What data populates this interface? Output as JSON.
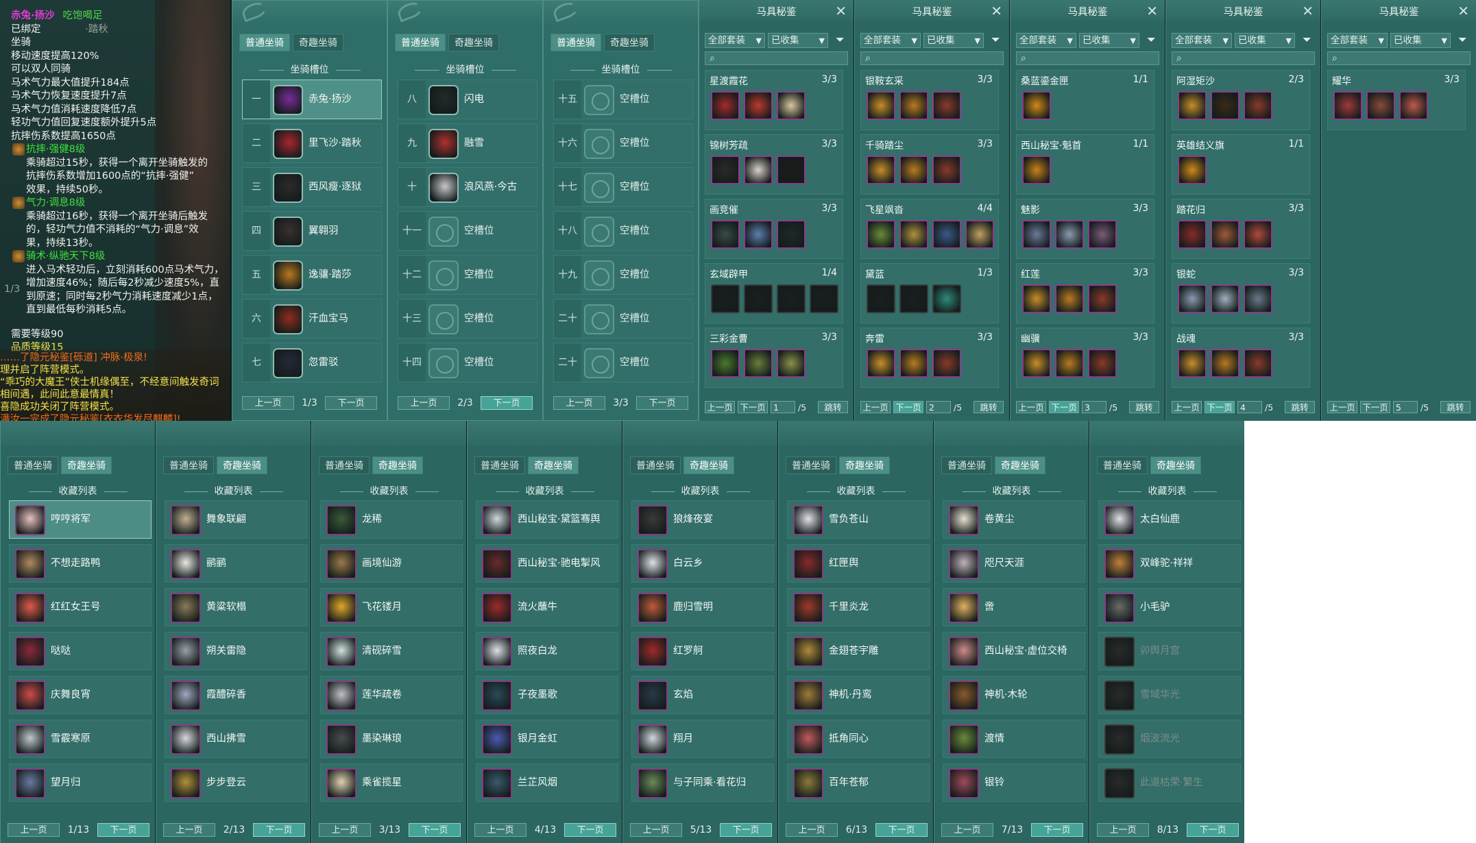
{
  "tooltip": {
    "title": "赤兔·扬沙",
    "title_sub": "吃饱喝足",
    "lines": [
      {
        "text": "已绑定",
        "color": "white",
        "extra": "·踏秋",
        "extra_color": "gray"
      },
      {
        "text": "坐骑",
        "color": "white"
      },
      {
        "text": "移动速度提高120%",
        "color": "white"
      },
      {
        "text": "可以双人同骑",
        "color": "white"
      },
      {
        "text": "马术气力最大值提升184点",
        "color": "white"
      },
      {
        "text": "马术气力恢复速度提升7点",
        "color": "white"
      },
      {
        "text": "马术气力值消耗速度降低7点",
        "color": "white"
      },
      {
        "text": "轻功气力值回复速度额外提升5点",
        "color": "white"
      },
      {
        "text": "抗摔伤系数提高1650点",
        "color": "white"
      },
      {
        "text": "抗摔·强健8级",
        "color": "green",
        "icon": true
      },
      {
        "text": "乘骑超过15秒，获得一个离开坐骑触发的",
        "color": "white",
        "ind": true
      },
      {
        "text": "抗摔伤系数增加1600点的“抗摔·强健”",
        "color": "white",
        "ind": true
      },
      {
        "text": "效果，持续50秒。",
        "color": "white",
        "ind": true
      },
      {
        "text": "气力·调息8级",
        "color": "green",
        "icon": true
      },
      {
        "text": "乘骑超过16秒，获得一个离开坐骑后触发",
        "color": "white",
        "ind": true
      },
      {
        "text": "的，轻功气力值不消耗的“气力·调息”效",
        "color": "white",
        "ind": true
      },
      {
        "text": "果，持续13秒。",
        "color": "white",
        "ind": true
      },
      {
        "text": "骑术·纵驰天下8级",
        "color": "green",
        "icon": true
      },
      {
        "text": "进入马术轻功后，立刻消耗600点马术气力，",
        "color": "white",
        "ind": true
      },
      {
        "text": "增加速度46%；随后每2秒减少速度5%，直",
        "color": "white",
        "ind": true
      },
      {
        "text": "到原速；同时每2秒气力消耗速度减少1点，",
        "color": "white",
        "ind": true
      },
      {
        "text": "直到最低每秒消耗5点。",
        "color": "white",
        "ind": true
      }
    ],
    "req_level": "需要等级90",
    "quality": "品质等级15",
    "bottom_lines": [
      {
        "text": "……了隐元秘鉴[砾道] 冲脉·极泉!",
        "color": "orange"
      },
      {
        "text": "理并启了阵营模式。",
        "color": "yellow"
      },
      {
        "text": "“乖巧的大魔王”侠士机缘偶至，不经意间触发奇词",
        "color": "yellow"
      },
      {
        "text": "相间遇，此间此意最情真！",
        "color": "yellow"
      },
      {
        "text": "喜隐成功关闭了阵营模式。",
        "color": "yellow"
      },
      {
        "text": "满汝一完成了隐元秘鉴[衣衣华发尽麒麟]!",
        "color": "orange"
      }
    ],
    "chip": "1/3"
  },
  "tabs": {
    "normal": "普通坐骑",
    "special": "奇趣坐骑"
  },
  "slots_title": "坐骑槽位",
  "collection_title": "收藏列表",
  "pager": {
    "prev": "上一页",
    "next": "下一页"
  },
  "slot_windows": [
    {
      "page": "1/3",
      "slots": [
        {
          "num": "一",
          "name": "赤兔·扬沙",
          "color": "#7b2a9a",
          "sel": true
        },
        {
          "num": "二",
          "name": "里飞沙·踏秋",
          "color": "#a8262e"
        },
        {
          "num": "三",
          "name": "西风瘦·逐狱",
          "color": "#2d2a2a"
        },
        {
          "num": "四",
          "name": "翼翱羽",
          "color": "#3a2f2f"
        },
        {
          "num": "五",
          "name": "逸骧·踏莎",
          "color": "#b8781f"
        },
        {
          "num": "六",
          "name": "汗血宝马",
          "color": "#8f2b20"
        },
        {
          "num": "七",
          "name": "忽雷驳",
          "color": "#26283a"
        }
      ]
    },
    {
      "page": "2/3",
      "slots": [
        {
          "num": "八",
          "name": "闪电",
          "color": "#222a2a"
        },
        {
          "num": "九",
          "name": "融雪",
          "color": "#b0302e"
        },
        {
          "num": "十",
          "name": "浪风燕·今古",
          "color": "#c8c6cc"
        },
        {
          "num": "十一",
          "name": "空槽位",
          "empty": true
        },
        {
          "num": "十二",
          "name": "空槽位",
          "empty": true
        },
        {
          "num": "十三",
          "name": "空槽位",
          "empty": true
        },
        {
          "num": "十四",
          "name": "空槽位",
          "empty": true
        }
      ]
    },
    {
      "page": "3/3",
      "slots": [
        {
          "num": "十五",
          "name": "空槽位",
          "empty": true
        },
        {
          "num": "十六",
          "name": "空槽位",
          "empty": true
        },
        {
          "num": "十七",
          "name": "空槽位",
          "empty": true
        },
        {
          "num": "十八",
          "name": "空槽位",
          "empty": true
        },
        {
          "num": "十九",
          "name": "空槽位",
          "empty": true
        },
        {
          "num": "二十",
          "name": "空槽位",
          "empty": true
        },
        {
          "num": "二十一",
          "name": "空槽位",
          "empty": true
        }
      ]
    }
  ],
  "equip_common": {
    "title": "马具秘鉴",
    "dd_all": "全部套装",
    "dd_collected": "已收集",
    "jump": "跳转",
    "prev": "上一页",
    "next": "下一页"
  },
  "equip_windows": [
    {
      "page": "1",
      "total": "/5",
      "sets": [
        {
          "name": "星渡霞花",
          "count": "3/3",
          "icons": [
            "#a32b2b",
            "#c0392b",
            "#d8c7a0"
          ]
        },
        {
          "name": "锦树芳疏",
          "count": "3/3",
          "icons": [
            "#2a2a2a",
            "#d9d0c8",
            "#1c1c1c"
          ]
        },
        {
          "name": "画竞催",
          "count": "3/3",
          "icons": [
            "#3a4a4a",
            "#5b7eb0",
            "#1e2a2a"
          ]
        },
        {
          "name": "玄域辟甲",
          "count": "1/4",
          "icons": [
            "#1a1f1f",
            "#1a1f1f",
            "#1a1f1f",
            "#1a1f1f"
          ],
          "dim": true
        },
        {
          "name": "三彩金曹",
          "count": "3/3",
          "icons": [
            "#4b7a2e",
            "#6a7e3a",
            "#8a8f4a"
          ]
        }
      ]
    },
    {
      "page": "2",
      "total": "/5",
      "sets": [
        {
          "name": "银鞍玄采",
          "count": "3/3",
          "icons": [
            "#c78d2a",
            "#b87a22",
            "#8a3a2a"
          ]
        },
        {
          "name": "千骑踏尘",
          "count": "3/3",
          "icons": [
            "#c78d2a",
            "#b87a22",
            "#8a3a2a"
          ]
        },
        {
          "name": "飞星飒沓",
          "count": "4/4",
          "icons": [
            "#6a8a3a",
            "#b09040",
            "#3a5a8a",
            "#c0a060"
          ]
        },
        {
          "name": "黛蓝",
          "count": "1/3",
          "icons": [
            "#1a1f1f",
            "#1a1f1f",
            "#2f8a7a"
          ],
          "dim": true
        },
        {
          "name": "奔雷",
          "count": "3/3",
          "icons": [
            "#c78d2a",
            "#b87a22",
            "#8a3a2a"
          ]
        }
      ]
    },
    {
      "page": "3",
      "total": "/5",
      "sets": [
        {
          "name": "桑蓝鎏金匣",
          "count": "1/1",
          "icons": [
            "#d08a1a"
          ]
        },
        {
          "name": "西山秘宝·魁首",
          "count": "1/1",
          "icons": [
            "#c8801a"
          ]
        },
        {
          "name": "魅影",
          "count": "3/3",
          "icons": [
            "#6a7a9a",
            "#8a9ab0",
            "#7a5a7a"
          ]
        },
        {
          "name": "红莲",
          "count": "3/3",
          "icons": [
            "#c78d2a",
            "#b87a22",
            "#8a3a2a"
          ]
        },
        {
          "name": "幽骥",
          "count": "3/3",
          "icons": [
            "#c78d2a",
            "#b87a22",
            "#8a3a2a"
          ]
        }
      ]
    },
    {
      "page": "4",
      "total": "/5",
      "sets": [
        {
          "name": "阿湿矩沙",
          "count": "2/3",
          "icons": [
            "#c78d2a",
            "#3a2a1a",
            "#8a3a2a"
          ]
        },
        {
          "name": "英雄结义旗",
          "count": "1/1",
          "icons": [
            "#d0881a"
          ]
        },
        {
          "name": "踏花归",
          "count": "3/3",
          "icons": [
            "#8a2a2a",
            "#a05a3a",
            "#b04a3a"
          ]
        },
        {
          "name": "银蛇",
          "count": "3/3",
          "icons": [
            "#8a9ab0",
            "#a0b0c0",
            "#6a7a8a"
          ]
        },
        {
          "name": "战魂",
          "count": "3/3",
          "icons": [
            "#c78d2a",
            "#b87a22",
            "#8a3a2a"
          ]
        }
      ]
    },
    {
      "page": "5",
      "total": "/5",
      "sets": [
        {
          "name": "耀华",
          "count": "3/3",
          "icons": [
            "#a03a3a",
            "#8a4a3a",
            "#c05a4a"
          ]
        }
      ]
    }
  ],
  "collection_windows": [
    {
      "page": "1/13",
      "items": [
        {
          "name": "哼哼将军",
          "color": "#e8c0c0",
          "sel": true
        },
        {
          "name": "不想走路鸭",
          "color": "#b08a60"
        },
        {
          "name": "红红女王号",
          "color": "#e05a4a"
        },
        {
          "name": "哒哒",
          "color": "#8a2a3a"
        },
        {
          "name": "庆舞良宵",
          "color": "#d04a4a"
        },
        {
          "name": "雪霰寒原",
          "color": "#c0c8d0"
        },
        {
          "name": "望月归",
          "color": "#6a7aa0"
        }
      ]
    },
    {
      "page": "2/13",
      "items": [
        {
          "name": "舞象联翩",
          "color": "#c0b090"
        },
        {
          "name": "鹂鹂",
          "color": "#e8e8e0"
        },
        {
          "name": "黄粱软榻",
          "color": "#8a7a5a"
        },
        {
          "name": "朔关雷隐",
          "color": "#9aa0a8"
        },
        {
          "name": "霞醴碎香",
          "color": "#a0a8c0"
        },
        {
          "name": "西山拂雪",
          "color": "#d8d8e0"
        },
        {
          "name": "步步登云",
          "color": "#b0903a"
        }
      ]
    },
    {
      "page": "3/13",
      "items": [
        {
          "name": "龙稀",
          "color": "#3a5a3a"
        },
        {
          "name": "画境仙游",
          "color": "#9a7a4a"
        },
        {
          "name": "飞花镂月",
          "color": "#e0a82a"
        },
        {
          "name": "清砚碎雪",
          "color": "#d0e0e0"
        },
        {
          "name": "莲华疏卷",
          "color": "#c0c0c8"
        },
        {
          "name": "墨染琳琅",
          "color": "#4a4a50"
        },
        {
          "name": "乘雀揽星",
          "color": "#e0d0b0"
        }
      ]
    },
    {
      "page": "4/13",
      "items": [
        {
          "name": "西山秘宝·黛篮骞舆",
          "color": "#d0d8e0"
        },
        {
          "name": "西山秘宝·驰电掣风",
          "color": "#6a2a2a"
        },
        {
          "name": "流火蘸牛",
          "color": "#a02a2a"
        },
        {
          "name": "照夜白龙",
          "color": "#e0e0e8"
        },
        {
          "name": "子夜墨歌",
          "color": "#2a4a5a"
        },
        {
          "name": "银月金虹",
          "color": "#4a5ab0"
        },
        {
          "name": "兰芷风烟",
          "color": "#3a5a6a"
        }
      ]
    },
    {
      "page": "5/13",
      "items": [
        {
          "name": "狼烽夜宴",
          "color": "#3a3a3a"
        },
        {
          "name": "白云乡",
          "color": "#e0e0e8"
        },
        {
          "name": "鹿归雪明",
          "color": "#c05a3a"
        },
        {
          "name": "红罗舸",
          "color": "#a02a2a"
        },
        {
          "name": "玄焰",
          "color": "#2a3a4a"
        },
        {
          "name": "翔月",
          "color": "#d0d8e0"
        },
        {
          "name": "与子同乘·看花归",
          "color": "#6a8a5a"
        }
      ]
    },
    {
      "page": "6/13",
      "items": [
        {
          "name": "雪负苍山",
          "color": "#e0e0e8"
        },
        {
          "name": "红匣舆",
          "color": "#8a2a2a"
        },
        {
          "name": "千里炎龙",
          "color": "#a03a2a"
        },
        {
          "name": "金翅苍宇雕",
          "color": "#b08a3a"
        },
        {
          "name": "神机·丹鸾",
          "color": "#a07a3a"
        },
        {
          "name": "抵角同心",
          "color": "#c05a5a"
        },
        {
          "name": "百年苍郁",
          "color": "#8a7a3a"
        }
      ]
    },
    {
      "page": "7/13",
      "items": [
        {
          "name": "卷黄尘",
          "color": "#e8e0d0"
        },
        {
          "name": "咫尺天涯",
          "color": "#c0b0b8"
        },
        {
          "name": "啻",
          "color": "#e0b060"
        },
        {
          "name": "西山秘宝·虚位交椅",
          "color": "#d08a8a"
        },
        {
          "name": "神机·木轮",
          "color": "#8a5a2a"
        },
        {
          "name": "渡情",
          "color": "#6a8a3a"
        },
        {
          "name": "银铃",
          "color": "#a04a5a"
        }
      ]
    },
    {
      "page": "8/13",
      "items": [
        {
          "name": "太白仙鹿",
          "color": "#e0e0e8"
        },
        {
          "name": "双峰驼·祥祥",
          "color": "#c0803a"
        },
        {
          "name": "小毛驴",
          "color": "#6a6a6a"
        },
        {
          "name": "卯舆月宫",
          "color": "#2a2a2a",
          "dim": true
        },
        {
          "name": "雪域华光",
          "color": "#2a2a2a",
          "dim": true
        },
        {
          "name": "烟波流光",
          "color": "#2a2a2a",
          "dim": true
        },
        {
          "name": "此道枯荣·繁生",
          "color": "#2a2a2a",
          "dim": true
        }
      ]
    }
  ]
}
